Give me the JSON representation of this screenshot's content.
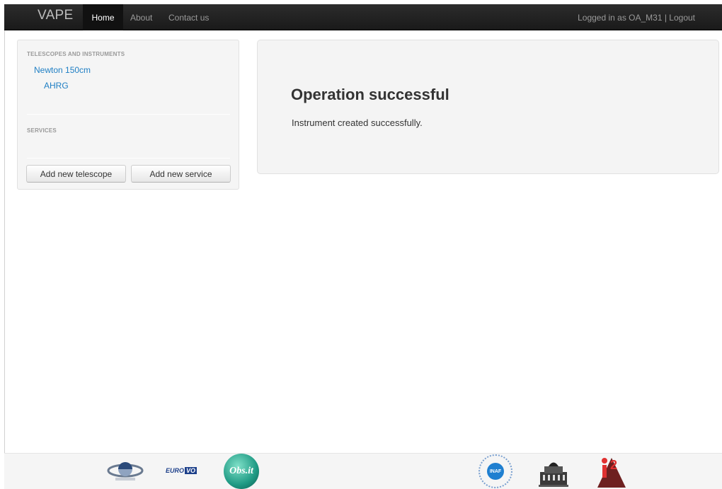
{
  "navbar": {
    "brand": "VAPE",
    "home": "Home",
    "about": "About",
    "contact": "Contact us",
    "user_status": "Logged in as OA_M31 | Logout"
  },
  "sidebar": {
    "telescopes_header": "TELESCOPES AND INSTRUMENTS",
    "telescope_name": "Newton 150cm",
    "instrument_name": "AHRG",
    "services_header": "SERVICES",
    "add_telescope": "Add new telescope",
    "add_service": "Add new service"
  },
  "main": {
    "title": "Operation successful",
    "message": "Instrument created successfully."
  },
  "footer": {
    "logos": [
      "globe-logo",
      "euro-vo-logo",
      "obs-it-logo",
      "inaf-logo",
      "observatory-building-logo",
      "ia2-logo"
    ],
    "euro_vo_text": "EURO",
    "euro_vo_box": "VO",
    "obs_text": "Obs.it",
    "inaf_text": "INAF",
    "ia2_text": "IA2"
  },
  "colors": {
    "link": "#1f7fc4",
    "navbar_bg": "#1a1a1a",
    "panel_bg": "#f5f5f5"
  }
}
